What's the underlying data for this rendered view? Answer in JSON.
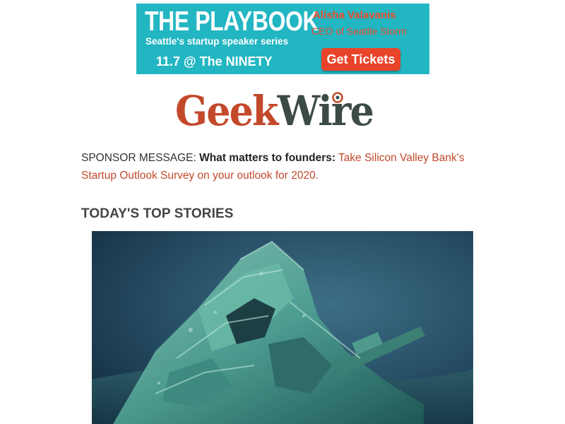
{
  "banner": {
    "title": "THE PLAYBOOK",
    "subtitle": "Seattle's startup speaker series",
    "event": "11.7 @ The NINETY",
    "speaker_name": "Alisha Valavanis",
    "speaker_role": "CEO of Seattle Storm",
    "cta_label": "Get Tickets",
    "colors": {
      "background": "#22b6c2",
      "accent": "#e8442a"
    }
  },
  "logo": {
    "part1": "Geek",
    "part2": "Wire",
    "colors": {
      "geek": "#c3492b",
      "wire": "#3d4b48"
    }
  },
  "sponsor": {
    "label": "SPONSOR MESSAGE: ",
    "strong": "What matters to founders:",
    "link_text": "Take Silicon Valley Bank's Startup Outlook Survey on your outlook for 2020."
  },
  "section": {
    "title": "TODAY'S TOP STORIES"
  },
  "story": {
    "image_icon": "shipwreck-photo"
  }
}
